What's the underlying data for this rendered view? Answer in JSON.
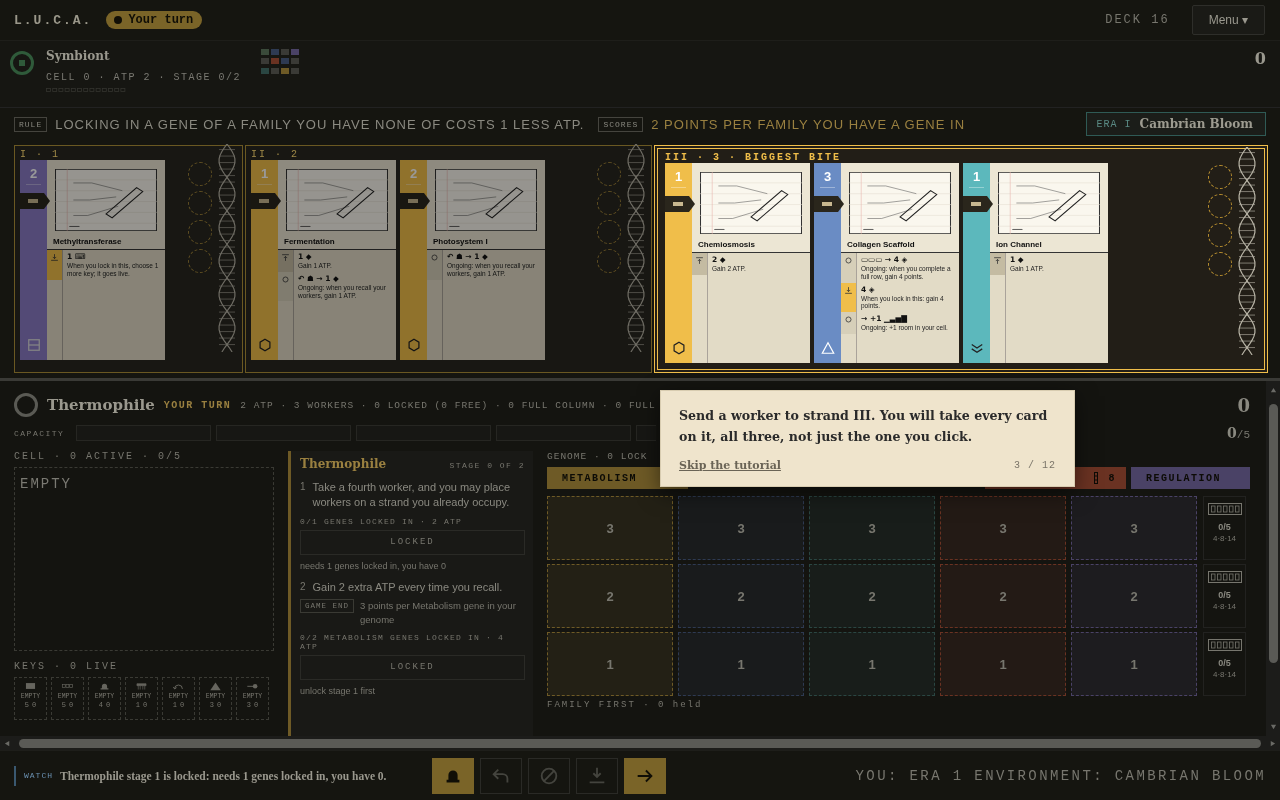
{
  "top_bar": {
    "logo": "L.U.C.A.",
    "turn_pill": "Your turn",
    "deck": "DECK 16",
    "menu": "Menu ▾"
  },
  "opponent": {
    "name": "Symbiont",
    "stats": "CELL 0 · ATP 2 · STAGE 0/2",
    "score": "0"
  },
  "rule_bar": {
    "rule_tag": "RULE",
    "rule": "LOCKING IN A GENE OF A FAMILY YOU HAVE NONE OF COSTS 1 LESS ATP.",
    "scores_tag": "SCORES",
    "scores": "2 POINTS PER FAMILY YOU HAVE A GENE IN",
    "era_tag": "ERA I",
    "era": "Cambrian Bloom"
  },
  "strands": [
    {
      "label": "I · 1",
      "highlighted": false,
      "cards": [
        {
          "name": "Methyltransferase",
          "cost": "2",
          "kind": "regulation",
          "abilities": [
            {
              "kind": "lock",
              "effect": "1 ⌨",
              "text": "When you lock in this, choose 1 more key; it goes live."
            }
          ]
        }
      ]
    },
    {
      "label": "II · 2",
      "highlighted": false,
      "cards": [
        {
          "name": "Fermentation",
          "cost": "1",
          "kind": "metabolism",
          "abilities": [
            {
              "kind": "instant",
              "effect": "1 ◆",
              "text": "Gain 1 ATP."
            },
            {
              "kind": "ongoing",
              "effect": "↶ ☗ → 1 ◆",
              "text": "Ongoing: when you recall your workers, gain 1 ATP."
            }
          ]
        },
        {
          "name": "Photosystem I",
          "cost": "2",
          "kind": "metabolism",
          "abilities": [
            {
              "kind": "ongoing",
              "effect": "↶ ☗ → 1 ◆",
              "text": "Ongoing: when you recall your workers, gain 1 ATP."
            }
          ]
        }
      ]
    },
    {
      "label": "III · 3 · BIGGEST BITE",
      "highlighted": true,
      "cards": [
        {
          "name": "Chemiosmosis",
          "cost": "1",
          "kind": "metabolism",
          "abilities": [
            {
              "kind": "instant",
              "effect": "2 ◆",
              "text": "Gain 2 ATP."
            }
          ]
        },
        {
          "name": "Collagen Scaffold",
          "cost": "3",
          "kind": "structure",
          "abilities": [
            {
              "kind": "ongoing",
              "effect": "▭▭▭ → 4 ◈",
              "text": "Ongoing: when you complete a full row, gain 4 points."
            },
            {
              "kind": "lock",
              "effect": "4 ◈",
              "text": "When you lock in this: gain 4 points."
            },
            {
              "kind": "ongoing",
              "effect": "→ +1 ▁▃▅▇",
              "text": "Ongoing: +1 room in your cell."
            }
          ]
        },
        {
          "name": "Ion Channel",
          "cost": "1",
          "kind": "transport",
          "abilities": [
            {
              "kind": "instant",
              "effect": "1 ◆",
              "text": "Gain 1 ATP."
            }
          ]
        }
      ]
    }
  ],
  "player": {
    "name": "Thermophile",
    "turn": "YOUR TURN",
    "stats": "2 ATP · 3 WORKERS · 0 LOCKED (0 FREE) · 0 FULL COLUMN · 0 FULL",
    "score": "0"
  },
  "capacity": {
    "label": "CAPACITY",
    "count": "0",
    "max": "/5"
  },
  "cell": {
    "header": "CELL · 0 ACTIVE · 0/5",
    "empty": "EMPTY"
  },
  "keys": {
    "header": "KEYS · 0 LIVE",
    "items": [
      {
        "kind": "grid",
        "status": "EMPTY",
        "number": "5",
        "count": "0"
      },
      {
        "kind": "chain",
        "status": "EMPTY",
        "number": "5",
        "count": "0"
      },
      {
        "kind": "dome",
        "status": "EMPTY",
        "number": "4",
        "count": "0"
      },
      {
        "kind": "comb",
        "status": "EMPTY",
        "number": "1",
        "count": "0"
      },
      {
        "kind": "recall",
        "status": "EMPTY",
        "number": "1",
        "count": "0"
      },
      {
        "kind": "triangle",
        "status": "EMPTY",
        "number": "3",
        "count": "0"
      },
      {
        "kind": "pin",
        "status": "EMPTY",
        "number": "3",
        "count": "0"
      }
    ]
  },
  "organism": {
    "title": "Thermophile",
    "stage": "STAGE 0 OF 2",
    "stages": [
      {
        "number": "1",
        "text": "Take a fourth worker, and you may place workers on a strand you already occupy.",
        "requirement": "0/1 GENES LOCKED IN · 2 ATP",
        "button": "LOCKED",
        "disabled": true,
        "note": "needs 1 genes locked in, you have 0"
      },
      {
        "number": "2",
        "text": "Gain 2 extra ATP every time you recall.",
        "tag": "GAME END",
        "tag_text": "3 points per Metabolism gene in your genome",
        "requirement": "0/2 METABOLISM GENES LOCKED IN · 4 ATP",
        "button": "LOCKED",
        "disabled": true,
        "note": "unlock stage 1 first"
      }
    ]
  },
  "genome": {
    "header": "GENOME · 0 LOCK",
    "families": [
      {
        "label": "METABOLISM",
        "color": "#6e5a26"
      },
      {
        "color": "#2e3a52"
      },
      {
        "color": "#2a4642"
      },
      {
        "count": "8",
        "color": "#6a3222"
      },
      {
        "label": "REGULATION",
        "color": "#4a4266"
      }
    ],
    "rows": [
      {
        "cells": [
          "3",
          "3",
          "3",
          "3",
          "3"
        ],
        "progress": "0/5",
        "thresholds": "4·8·14"
      },
      {
        "cells": [
          "2",
          "2",
          "2",
          "2",
          "2"
        ],
        "progress": "0/5",
        "thresholds": "4·8·14"
      },
      {
        "cells": [
          "1",
          "1",
          "1",
          "1",
          "1"
        ],
        "progress": "0/5",
        "thresholds": "4·8·14"
      }
    ],
    "footer": "FAMILY FIRST · 0 held"
  },
  "tooltip": {
    "text": "Send a worker to strand III. You will take every card on it, all three, not just the one you click.",
    "skip": "Skip the tutorial",
    "step": "3 / 12"
  },
  "bottom_bar": {
    "tag": "WATCH",
    "message": "Thermophile stage 1 is locked: needs 1 genes locked in, you have 0.",
    "actions": [
      {
        "kind": "worker",
        "disabled": false
      },
      {
        "kind": "recall",
        "disabled": true
      },
      {
        "kind": "ban",
        "disabled": true
      },
      {
        "kind": "lock",
        "disabled": true
      },
      {
        "kind": "next",
        "disabled": false
      }
    ],
    "status": "YOU: ERA 1 ENVIRONMENT: CAMBRIAN BLOOM"
  }
}
